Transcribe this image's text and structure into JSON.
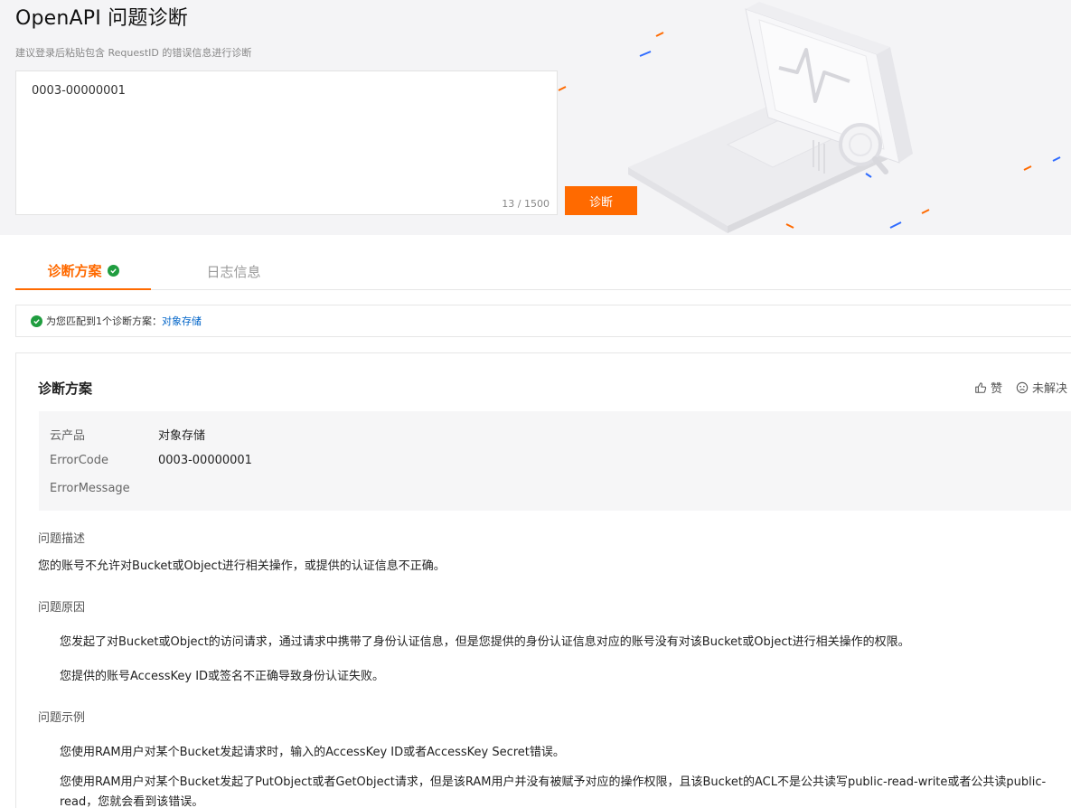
{
  "header": {
    "title": "OpenAPI 问题诊断",
    "subtitle": "建议登录后粘贴包含 RequestID 的错误信息进行诊断"
  },
  "query": {
    "value": "0003-00000001",
    "counter": "13 / 1500",
    "submit_label": "诊断"
  },
  "tabs": [
    {
      "label": "诊断方案",
      "active": true
    },
    {
      "label": "日志信息",
      "active": false
    }
  ],
  "match_banner": {
    "text": "为您匹配到1个诊断方案：",
    "link": "对象存储"
  },
  "solution": {
    "title": "诊断方案",
    "like_label": "赞",
    "unsolved_label": "未解决",
    "info": [
      {
        "label": "云产品",
        "value": "对象存储"
      },
      {
        "label": "ErrorCode",
        "value": "0003-00000001"
      },
      {
        "label": "ErrorMessage",
        "value": ""
      }
    ],
    "description": {
      "heading": "问题描述",
      "text": "您的账号不允许对Bucket或Object进行相关操作，或提供的认证信息不正确。"
    },
    "causes": {
      "heading": "问题原因",
      "items": [
        "您发起了对Bucket或Object的访问请求，通过请求中携带了身份认证信息，但是您提供的身份认证信息对应的账号没有对该Bucket或Object进行相关操作的权限。",
        "您提供的账号AccessKey ID或签名不正确导致身份认证失败。"
      ]
    },
    "examples": {
      "heading": "问题示例",
      "items": [
        "您使用RAM用户对某个Bucket发起请求时，输入的AccessKey ID或者AccessKey Secret错误。",
        "您使用RAM用户对某个Bucket发起了PutObject或者GetObject请求，但是该RAM用户并没有被赋予对应的操作权限，且该Bucket的ACL不是公共读写public-read-write或者公共读public-read，您就会看到该错误。"
      ]
    }
  },
  "colors": {
    "accent": "#ff6a00",
    "success": "#1f9d3f",
    "link": "#0064c8"
  },
  "icons": {
    "tab_status": "check-circle-icon",
    "banner_status": "check-circle-icon",
    "like": "thumbs-up-icon",
    "unsolved": "frown-face-icon",
    "hero": "monitor-diagnosis-illustration"
  }
}
